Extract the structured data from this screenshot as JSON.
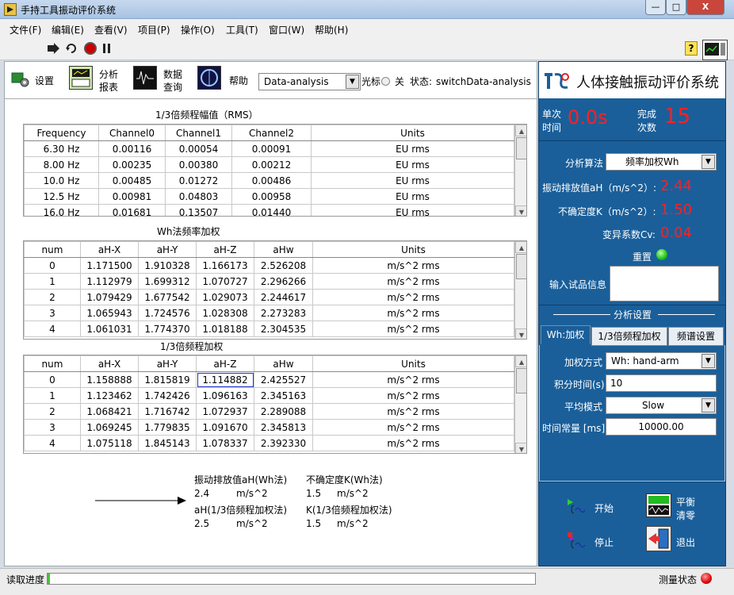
{
  "window": {
    "title": "手持工具振动评价系统",
    "btn_min": "—",
    "btn_max": "□",
    "btn_close": "X"
  },
  "menu": [
    "文件(F)",
    "编辑(E)",
    "查看(V)",
    "项目(P)",
    "操作(O)",
    "工具(T)",
    "窗口(W)",
    "帮助(H)"
  ],
  "toolbar": {
    "help_symbol": "?"
  },
  "top": {
    "settings": "设置",
    "analysis_l1": "分析",
    "analysis_l2": "报表",
    "data_l1": "数据",
    "data_l2": "查询",
    "help": "帮助",
    "mode_value": "Data-analysis",
    "cursor_label": "光标",
    "cursor_state": "关",
    "status_label": "状态:",
    "status_value": "switchData-analysis"
  },
  "table1": {
    "title": "1/3倍频程幅值（RMS）",
    "headers": [
      "Frequency",
      "Channel0",
      "Channel1",
      "Channel2",
      "Units"
    ],
    "rows": [
      [
        "6.30 Hz",
        "0.00116",
        "0.00054",
        "0.00091",
        "EU rms"
      ],
      [
        "8.00 Hz",
        "0.00235",
        "0.00380",
        "0.00212",
        "EU rms"
      ],
      [
        "10.0 Hz",
        "0.00485",
        "0.01272",
        "0.00486",
        "EU rms"
      ],
      [
        "12.5 Hz",
        "0.00981",
        "0.04803",
        "0.00958",
        "EU rms"
      ],
      [
        "16.0 Hz",
        "0.01681",
        "0.13507",
        "0.01440",
        "EU rms"
      ]
    ]
  },
  "table2": {
    "title": "Wh法频率加权",
    "headers": [
      "num",
      "aH-X",
      "aH-Y",
      "aH-Z",
      "aHw",
      "Units"
    ],
    "rows": [
      [
        "0",
        "1.171500",
        "1.910328",
        "1.166173",
        "2.526208",
        "m/s^2 rms"
      ],
      [
        "1",
        "1.112979",
        "1.699312",
        "1.070727",
        "2.296266",
        "m/s^2 rms"
      ],
      [
        "2",
        "1.079429",
        "1.677542",
        "1.029073",
        "2.244617",
        "m/s^2 rms"
      ],
      [
        "3",
        "1.065943",
        "1.724576",
        "1.028308",
        "2.273283",
        "m/s^2 rms"
      ],
      [
        "4",
        "1.061031",
        "1.774370",
        "1.018188",
        "2.304535",
        "m/s^2 rms"
      ]
    ]
  },
  "table3": {
    "title": "1/3倍频程加权",
    "headers": [
      "num",
      "aH-X",
      "aH-Y",
      "aH-Z",
      "aHw",
      "Units"
    ],
    "rows": [
      [
        "0",
        "1.158888",
        "1.815819",
        "1.114882",
        "2.425527",
        "m/s^2 rms"
      ],
      [
        "1",
        "1.123462",
        "1.742426",
        "1.096163",
        "2.345163",
        "m/s^2 rms"
      ],
      [
        "2",
        "1.068421",
        "1.716742",
        "1.072937",
        "2.289088",
        "m/s^2 rms"
      ],
      [
        "3",
        "1.069245",
        "1.779835",
        "1.091670",
        "2.345813",
        "m/s^2 rms"
      ],
      [
        "4",
        "1.075118",
        "1.845143",
        "1.078337",
        "2.392330",
        "m/s^2 rms"
      ]
    ]
  },
  "summary": {
    "wh_title": "振动排放值aH(Wh法)",
    "wh_value": "2.4",
    "wh_unit": "m/s^2",
    "k_wh_title": "不确定度K(Wh法)",
    "k_wh_value": "1.5",
    "k_wh_unit": "m/s^2",
    "oct_title": "aH(1/3倍频程加权法)",
    "oct_value": "2.5",
    "oct_unit": "m/s^2",
    "k_oct_title": "K(1/3倍频程加权法)",
    "k_oct_value": "1.5",
    "k_oct_unit": "m/s^2"
  },
  "right": {
    "brand": "人体接触振动评价系统",
    "single_time_l1": "单次",
    "single_time_l2": "时间",
    "single_time_value": "0.0s",
    "done_l1": "完成",
    "done_l2": "次数",
    "done_value": "15",
    "algo_label": "分析算法",
    "algo_value": "频率加权Wh",
    "ah_label": "振动排放值aH（m/s^2）:",
    "ah_value": "2.44",
    "k_label": "不确定度K（m/s^2）:",
    "k_value": "1.50",
    "cv_label": "变异系数Cv:",
    "cv_value": "0.04",
    "reset_label": "重置",
    "sample_label": "输入试品信息",
    "sample_value": "",
    "settings_title": "分析设置",
    "tabs": [
      "Wh:加权",
      "1/3倍频程加权",
      "频谱设置"
    ],
    "weight_label": "加权方式",
    "weight_value": "Wh: hand-arm",
    "integ_label": "积分时间(s)",
    "integ_value": "10",
    "avg_label": "平均模式",
    "avg_value": "Slow",
    "tc_label": "时间常量 [ms]",
    "tc_value": "10000.00",
    "start": "开始",
    "balance_l1": "平衡",
    "balance_l2": "清零",
    "stop": "停止",
    "exit": "退出"
  },
  "bottom": {
    "progress_label": "读取进度",
    "progress": 0.0,
    "measure_label": "测量状态"
  },
  "colors": {
    "panel_blue": "#1a5f9a",
    "red_value": "#ff2020",
    "led_green": "#28c828",
    "led_red": "#e01010"
  }
}
